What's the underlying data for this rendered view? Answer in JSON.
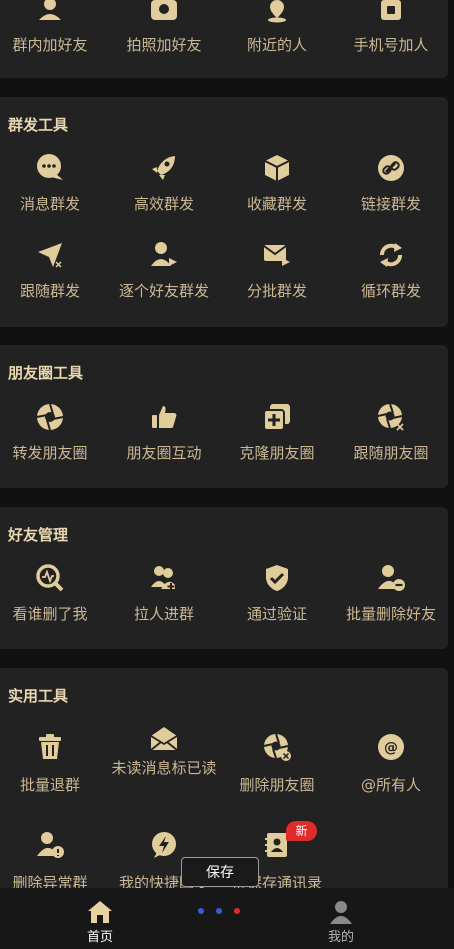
{
  "sections": {
    "add_friends": {
      "items": [
        {
          "label": "群内加好友"
        },
        {
          "label": "拍照加好友"
        },
        {
          "label": "附近的人"
        },
        {
          "label": "手机号加人"
        }
      ]
    },
    "mass_send": {
      "title": "群发工具",
      "items": [
        {
          "label": "消息群发"
        },
        {
          "label": "高效群发"
        },
        {
          "label": "收藏群发"
        },
        {
          "label": "链接群发"
        },
        {
          "label": "跟随群发"
        },
        {
          "label": "逐个好友群发"
        },
        {
          "label": "分批群发"
        },
        {
          "label": "循环群发"
        }
      ]
    },
    "moments": {
      "title": "朋友圈工具",
      "items": [
        {
          "label": "转发朋友圈"
        },
        {
          "label": "朋友圈互动"
        },
        {
          "label": "克隆朋友圈"
        },
        {
          "label": "跟随朋友圈"
        }
      ]
    },
    "friend_mgmt": {
      "title": "好友管理",
      "items": [
        {
          "label": "看谁删了我"
        },
        {
          "label": "拉人进群"
        },
        {
          "label": "通过验证"
        },
        {
          "label": "批量删除好友"
        }
      ]
    },
    "utility": {
      "title": "实用工具",
      "items": [
        {
          "label": "批量退群"
        },
        {
          "label": "未读消息标已读"
        },
        {
          "label": "删除朋友圈"
        },
        {
          "label": "@所有人"
        },
        {
          "label": "删除异常群"
        },
        {
          "label": "我的快捷回复"
        },
        {
          "label": "群保存通讯录"
        }
      ],
      "badge": "新"
    }
  },
  "save_button": "保存",
  "bottom_nav": {
    "home": "首页",
    "mine": "我的"
  },
  "colors": {
    "background": "#111111",
    "card": "#222222",
    "accent_gold": "#e1cc9c",
    "badge_red": "#e02b2b",
    "dot_blue": "#3a5bd9",
    "dot_red": "#e02b2b"
  }
}
